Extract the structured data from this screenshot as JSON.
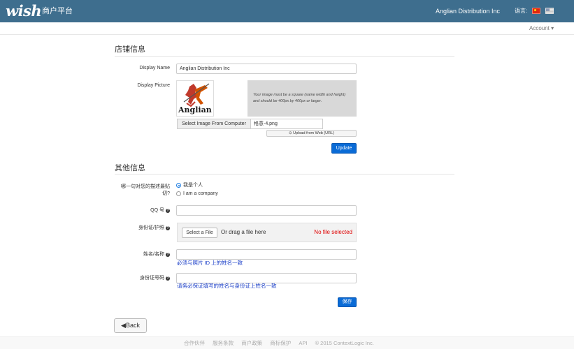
{
  "header": {
    "logo": "wish",
    "subtitle": "商户平台",
    "merchant_name": "Anglian Distribution Inc",
    "language_label": "语言:",
    "flags": [
      "cn-flag",
      "us-flag"
    ]
  },
  "subnav": {
    "account": "Account ▾"
  },
  "store_info": {
    "title": "店铺信息",
    "display_name_label": "Display Name",
    "display_name_value": "Anglian Distribution Inc",
    "display_picture_label": "Display Picture",
    "picture_logo_text": "Anglian",
    "picture_note": "Your image must be a square (same width and height) and should be 400px by 400px or larger.",
    "select_image_button": "Select Image From Computer",
    "selected_filename": "格意-4.png",
    "upload_web_button": "Upload from Web (URL)",
    "update_button": "Update"
  },
  "other_info": {
    "title": "其他信息",
    "describe_label": "哪一句对您的描述最贴切?",
    "options": [
      "我是个人",
      "I am a company"
    ],
    "selected_option": 0,
    "qq_label": "QQ 号",
    "qq_value": "",
    "id_photo_label": "身份证/护照",
    "select_file_button": "Select a File",
    "drag_text": "Or drag a file here",
    "no_file_text": "No file selected",
    "name_label": "姓名/名称",
    "name_value": "",
    "name_hint": "必须与照片 ID 上的姓名一致",
    "id_number_label": "身份证号码",
    "id_number_value": "",
    "id_number_hint": "请务必保证填写的姓名与身份证上姓名一致",
    "save_button": "保存"
  },
  "back_button": "◀Back",
  "footer": {
    "links": [
      "合作伙伴",
      "服务条款",
      "商户政策",
      "商标保护",
      "API"
    ],
    "copyright": "© 2015 ContextLogic Inc."
  },
  "colors": {
    "topbar": "#3e6e8e",
    "primary_button": "#0a6bd6",
    "error_text": "#e00000",
    "hint_text": "#1a3ec8"
  }
}
